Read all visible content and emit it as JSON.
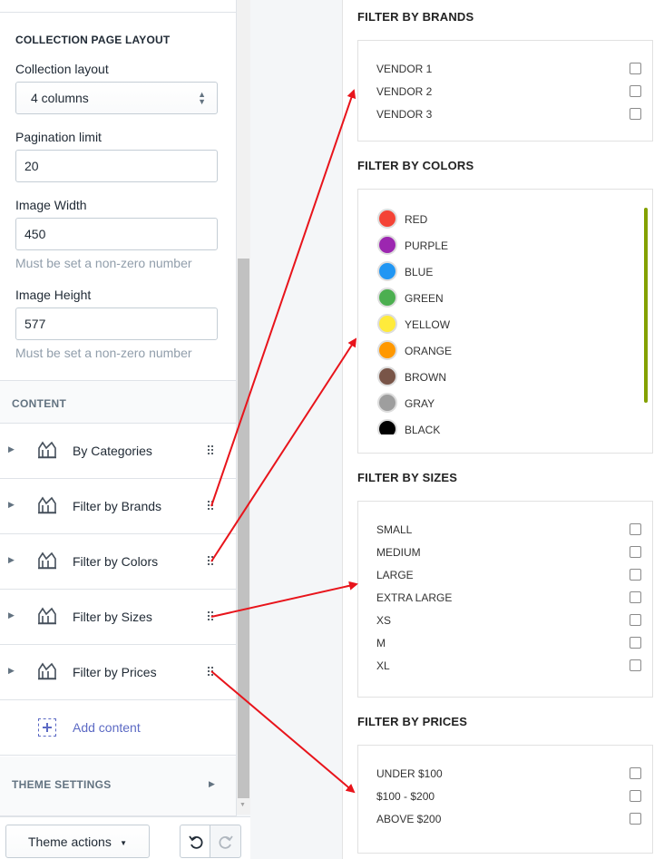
{
  "sidebar": {
    "section_title": "COLLECTION PAGE LAYOUT",
    "collection_layout": {
      "label": "Collection layout",
      "value": "4 columns"
    },
    "pagination_limit": {
      "label": "Pagination limit",
      "value": "20"
    },
    "image_width": {
      "label": "Image Width",
      "value": "450",
      "help": "Must be set a non-zero number"
    },
    "image_height": {
      "label": "Image Height",
      "value": "577",
      "help": "Must be set a non-zero number"
    },
    "content_header": "CONTENT",
    "blocks": [
      {
        "label": "By Categories"
      },
      {
        "label": "Filter by Brands"
      },
      {
        "label": "Filter by Colors"
      },
      {
        "label": "Filter by Sizes"
      },
      {
        "label": "Filter by Prices"
      }
    ],
    "add_content": "Add content",
    "theme_settings": "THEME SETTINGS"
  },
  "bottom_bar": {
    "theme_actions": "Theme actions"
  },
  "preview": {
    "brands": {
      "title": "FILTER BY BRANDS",
      "items": [
        "VENDOR 1",
        "VENDOR 2",
        "VENDOR 3"
      ]
    },
    "colors": {
      "title": "FILTER BY COLORS",
      "items": [
        {
          "label": "RED",
          "color": "#f44336"
        },
        {
          "label": "PURPLE",
          "color": "#9c27b0"
        },
        {
          "label": "BLUE",
          "color": "#2196f3"
        },
        {
          "label": "GREEN",
          "color": "#4caf50"
        },
        {
          "label": "YELLOW",
          "color": "#ffeb3b"
        },
        {
          "label": "ORANGE",
          "color": "#ff9800"
        },
        {
          "label": "BROWN",
          "color": "#795548"
        },
        {
          "label": "GRAY",
          "color": "#9e9e9e"
        },
        {
          "label": "BLACK",
          "color": "#000000"
        }
      ]
    },
    "sizes": {
      "title": "FILTER BY SIZES",
      "items": [
        "SMALL",
        "MEDIUM",
        "LARGE",
        "EXTRA LARGE",
        "XS",
        "M",
        "XL"
      ]
    },
    "prices": {
      "title": "FILTER BY PRICES",
      "items": [
        "UNDER $100",
        "$100 - $200",
        "ABOVE $200"
      ]
    }
  },
  "colors": {
    "accent": "#5c6ac4",
    "annotation_arrow": "#e8141b",
    "scroll_indicator": "#84a100"
  }
}
